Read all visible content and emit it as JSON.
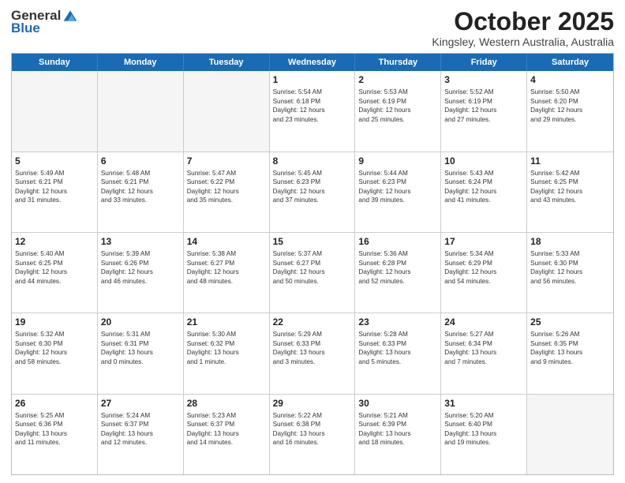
{
  "logo": {
    "general": "General",
    "blue": "Blue"
  },
  "title": "October 2025",
  "location": "Kingsley, Western Australia, Australia",
  "days_of_week": [
    "Sunday",
    "Monday",
    "Tuesday",
    "Wednesday",
    "Thursday",
    "Friday",
    "Saturday"
  ],
  "weeks": [
    [
      {
        "day": "",
        "content": ""
      },
      {
        "day": "",
        "content": ""
      },
      {
        "day": "",
        "content": ""
      },
      {
        "day": "1",
        "content": "Sunrise: 5:54 AM\nSunset: 6:18 PM\nDaylight: 12 hours\nand 23 minutes."
      },
      {
        "day": "2",
        "content": "Sunrise: 5:53 AM\nSunset: 6:19 PM\nDaylight: 12 hours\nand 25 minutes."
      },
      {
        "day": "3",
        "content": "Sunrise: 5:52 AM\nSunset: 6:19 PM\nDaylight: 12 hours\nand 27 minutes."
      },
      {
        "day": "4",
        "content": "Sunrise: 5:50 AM\nSunset: 6:20 PM\nDaylight: 12 hours\nand 29 minutes."
      }
    ],
    [
      {
        "day": "5",
        "content": "Sunrise: 5:49 AM\nSunset: 6:21 PM\nDaylight: 12 hours\nand 31 minutes."
      },
      {
        "day": "6",
        "content": "Sunrise: 5:48 AM\nSunset: 6:21 PM\nDaylight: 12 hours\nand 33 minutes."
      },
      {
        "day": "7",
        "content": "Sunrise: 5:47 AM\nSunset: 6:22 PM\nDaylight: 12 hours\nand 35 minutes."
      },
      {
        "day": "8",
        "content": "Sunrise: 5:45 AM\nSunset: 6:23 PM\nDaylight: 12 hours\nand 37 minutes."
      },
      {
        "day": "9",
        "content": "Sunrise: 5:44 AM\nSunset: 6:23 PM\nDaylight: 12 hours\nand 39 minutes."
      },
      {
        "day": "10",
        "content": "Sunrise: 5:43 AM\nSunset: 6:24 PM\nDaylight: 12 hours\nand 41 minutes."
      },
      {
        "day": "11",
        "content": "Sunrise: 5:42 AM\nSunset: 6:25 PM\nDaylight: 12 hours\nand 43 minutes."
      }
    ],
    [
      {
        "day": "12",
        "content": "Sunrise: 5:40 AM\nSunset: 6:25 PM\nDaylight: 12 hours\nand 44 minutes."
      },
      {
        "day": "13",
        "content": "Sunrise: 5:39 AM\nSunset: 6:26 PM\nDaylight: 12 hours\nand 46 minutes."
      },
      {
        "day": "14",
        "content": "Sunrise: 5:38 AM\nSunset: 6:27 PM\nDaylight: 12 hours\nand 48 minutes."
      },
      {
        "day": "15",
        "content": "Sunrise: 5:37 AM\nSunset: 6:27 PM\nDaylight: 12 hours\nand 50 minutes."
      },
      {
        "day": "16",
        "content": "Sunrise: 5:36 AM\nSunset: 6:28 PM\nDaylight: 12 hours\nand 52 minutes."
      },
      {
        "day": "17",
        "content": "Sunrise: 5:34 AM\nSunset: 6:29 PM\nDaylight: 12 hours\nand 54 minutes."
      },
      {
        "day": "18",
        "content": "Sunrise: 5:33 AM\nSunset: 6:30 PM\nDaylight: 12 hours\nand 56 minutes."
      }
    ],
    [
      {
        "day": "19",
        "content": "Sunrise: 5:32 AM\nSunset: 6:30 PM\nDaylight: 12 hours\nand 58 minutes."
      },
      {
        "day": "20",
        "content": "Sunrise: 5:31 AM\nSunset: 6:31 PM\nDaylight: 13 hours\nand 0 minutes."
      },
      {
        "day": "21",
        "content": "Sunrise: 5:30 AM\nSunset: 6:32 PM\nDaylight: 13 hours\nand 1 minute."
      },
      {
        "day": "22",
        "content": "Sunrise: 5:29 AM\nSunset: 6:33 PM\nDaylight: 13 hours\nand 3 minutes."
      },
      {
        "day": "23",
        "content": "Sunrise: 5:28 AM\nSunset: 6:33 PM\nDaylight: 13 hours\nand 5 minutes."
      },
      {
        "day": "24",
        "content": "Sunrise: 5:27 AM\nSunset: 6:34 PM\nDaylight: 13 hours\nand 7 minutes."
      },
      {
        "day": "25",
        "content": "Sunrise: 5:26 AM\nSunset: 6:35 PM\nDaylight: 13 hours\nand 9 minutes."
      }
    ],
    [
      {
        "day": "26",
        "content": "Sunrise: 5:25 AM\nSunset: 6:36 PM\nDaylight: 13 hours\nand 11 minutes."
      },
      {
        "day": "27",
        "content": "Sunrise: 5:24 AM\nSunset: 6:37 PM\nDaylight: 13 hours\nand 12 minutes."
      },
      {
        "day": "28",
        "content": "Sunrise: 5:23 AM\nSunset: 6:37 PM\nDaylight: 13 hours\nand 14 minutes."
      },
      {
        "day": "29",
        "content": "Sunrise: 5:22 AM\nSunset: 6:38 PM\nDaylight: 13 hours\nand 16 minutes."
      },
      {
        "day": "30",
        "content": "Sunrise: 5:21 AM\nSunset: 6:39 PM\nDaylight: 13 hours\nand 18 minutes."
      },
      {
        "day": "31",
        "content": "Sunrise: 5:20 AM\nSunset: 6:40 PM\nDaylight: 13 hours\nand 19 minutes."
      },
      {
        "day": "",
        "content": ""
      }
    ]
  ]
}
